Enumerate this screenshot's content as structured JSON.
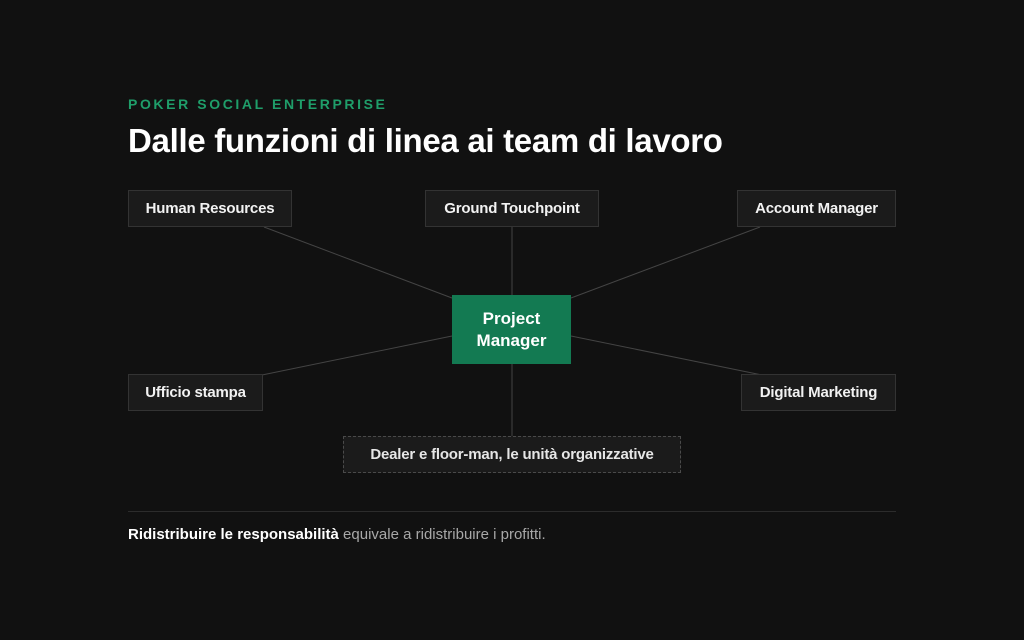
{
  "header": {
    "eyebrow": "POKER SOCIAL ENTERPRISE",
    "title": "Dalle funzioni di linea ai team di lavoro"
  },
  "diagram": {
    "center": {
      "line1": "Project",
      "line2": "Manager"
    },
    "nodes": {
      "human_resources": "Human Resources",
      "ground_touchpoint": "Ground Touchpoint",
      "account_manager": "Account Manager",
      "ufficio_stampa": "Ufficio stampa",
      "digital_marketing": "Digital Marketing",
      "dealer_floor": "Dealer e floor-man, le unità organizzative"
    }
  },
  "footer": {
    "strong": "Ridistribuire le responsabilità",
    "rest": " equivale a ridistribuire i profitti."
  },
  "colors": {
    "background": "#111111",
    "accent": "#1f9e6a",
    "center_fill": "#137a52",
    "node_fill": "#1b1b1b",
    "connector": "#444444"
  }
}
